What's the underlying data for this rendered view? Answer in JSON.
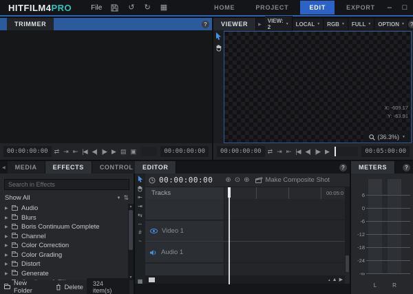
{
  "titlebar": {
    "logo_main": "HITFILM4",
    "logo_accent": "PRO",
    "menu_file": "File",
    "tabs": [
      {
        "label": "HOME",
        "active": false
      },
      {
        "label": "PROJECT",
        "active": false
      },
      {
        "label": "EDIT",
        "active": true
      },
      {
        "label": "EXPORT",
        "active": false
      }
    ]
  },
  "icons": {
    "help": "?",
    "minimize": "–",
    "maximize": "□",
    "close": "×",
    "undo": "↺",
    "redo": "↻",
    "grid": "▦",
    "loop": "⇄",
    "out_point": "⇥",
    "in_point": "⇤",
    "skip_start": "|◀",
    "step_back": "◀|",
    "step_fwd": "|▶",
    "play": "▶",
    "snapshot": "▤",
    "export_frame": "▣",
    "caret_down": "▼",
    "caret_left": "◀",
    "caret_right": "▶",
    "expand": "▶",
    "sort": "⇅",
    "scroll_up": "▲",
    "scroll_down": "▼",
    "circle_in": "⊕",
    "circle_mid": "⊙",
    "circle_out": "⊕",
    "film": "▦",
    "mask_u": "U",
    "zoom_tri_small": "▴",
    "zoom_tri_big": "▲"
  },
  "trimmer": {
    "title": "TRIMMER",
    "timecode_left": "00:00:00:00",
    "timecode_right": "00:00:00:00"
  },
  "viewer": {
    "title": "VIEWER",
    "dropdowns": [
      "VIEW: 2",
      "LOCAL",
      "RGB",
      "FULL",
      "OPTION"
    ],
    "coords": {
      "x": "X:  -609.17",
      "y": "Y:   -63.91"
    },
    "zoom_level": "(36.3%)",
    "timecode_left": "00:00:00:00",
    "timecode_right": "00:05:00:00"
  },
  "effects": {
    "tabs": [
      {
        "label": "MEDIA",
        "active": false
      },
      {
        "label": "EFFECTS",
        "active": true
      },
      {
        "label": "CONTROL",
        "active": false
      }
    ],
    "search_placeholder": "Search in Effects",
    "filter_label": "Show All",
    "folders": [
      "Audio",
      "Blurs",
      "Boris Continuum Complete",
      "Channel",
      "Color Correction",
      "Color Grading",
      "Distort",
      "Generate",
      "Gradients & Fills"
    ],
    "footer": {
      "new_folder": "New Folder",
      "delete": "Delete",
      "count": "324 item(s)"
    }
  },
  "editor": {
    "title": "EDITOR",
    "timecode": "00:00:00:00",
    "make_composite": "Make Composite Shot",
    "tools_glyphs": [
      "⇤",
      "⇥",
      "⇆",
      "↔",
      "#",
      "~"
    ],
    "tracks_label": "Tracks",
    "ruler_end": "00:05:0",
    "tracks": [
      {
        "name": "Video 1"
      },
      {
        "name": "Audio 1"
      }
    ]
  },
  "meters": {
    "title": "METERS",
    "scale": [
      "6",
      "0",
      "-6",
      "-12",
      "-18",
      "-24",
      "-∞"
    ],
    "channels": [
      "L",
      "R"
    ]
  }
}
